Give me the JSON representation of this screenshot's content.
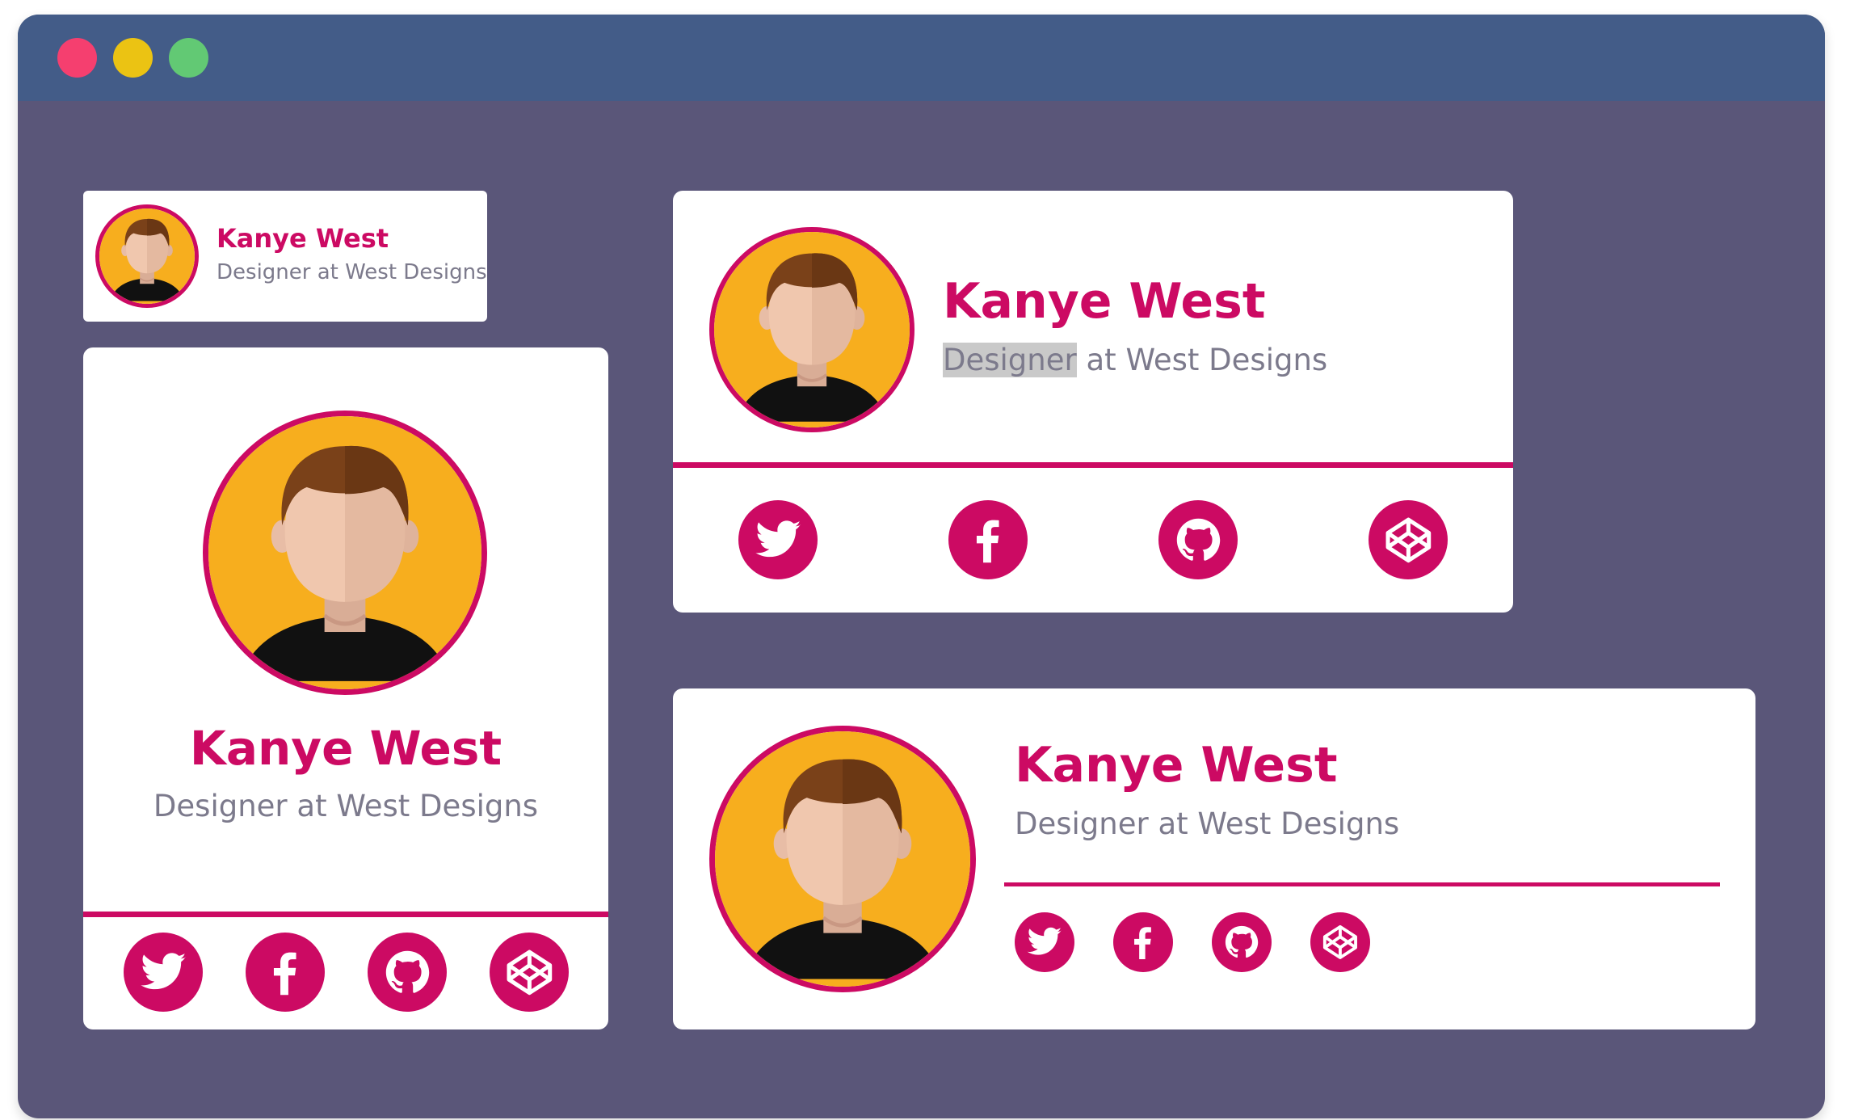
{
  "window": {
    "controls": [
      "close",
      "minimize",
      "maximize"
    ],
    "colors": {
      "background": "#5a5679",
      "titlebar": "#435c88",
      "close": "#f53f6f",
      "minimize": "#ebc313",
      "maximize": "#62c974"
    }
  },
  "theme": {
    "accent": "#cc0a63",
    "avatar_bg": "#f7ae1e",
    "hair": "#7a4119",
    "skin": "#f0c7ae",
    "shirt": "#111111",
    "text_muted": "#7c7a8c"
  },
  "cards": {
    "small": {
      "name": "Kanye West",
      "role": "Designer at West Designs"
    },
    "vertical": {
      "name": "Kanye West",
      "role": "Designer at West Designs",
      "social": [
        "twitter-icon",
        "facebook-icon",
        "github-icon",
        "codepen-icon"
      ]
    },
    "horizontal": {
      "name": "Kanye West",
      "role_highlight": "Designer",
      "role_rest": " at West Designs",
      "social": [
        "twitter-icon",
        "facebook-icon",
        "github-icon",
        "codepen-icon"
      ]
    },
    "wide": {
      "name": "Kanye West",
      "role": "Designer at West Designs",
      "social": [
        "twitter-icon",
        "facebook-icon",
        "github-icon",
        "codepen-icon"
      ]
    }
  }
}
